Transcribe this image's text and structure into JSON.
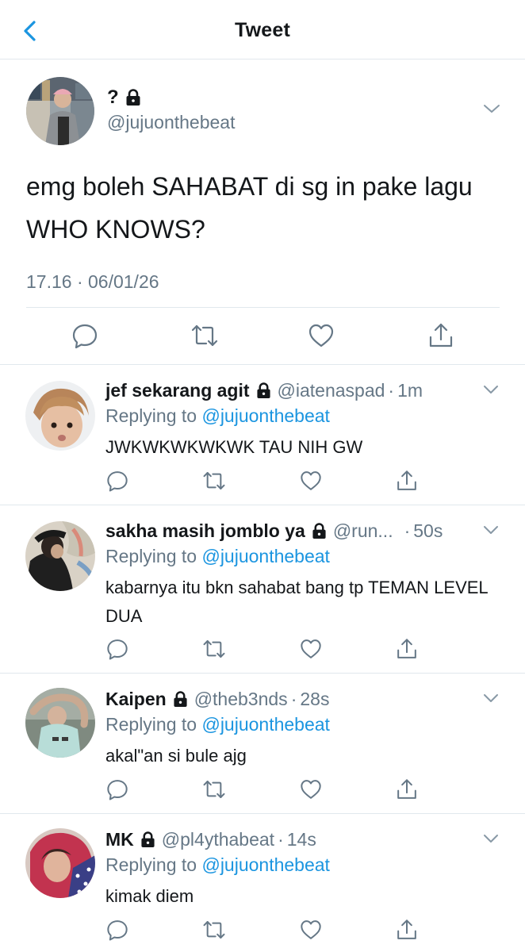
{
  "header": {
    "title": "Tweet",
    "accent_color": "#1b95e0"
  },
  "main_tweet": {
    "display_name": "?",
    "handle": "@jujuonthebeat",
    "text": "emg boleh SAHABAT di sg in pake lagu WHO KNOWS?",
    "timestamp": "17.16 · 06/01/26",
    "protected": true
  },
  "replies": [
    {
      "display_name": "jef sekarang agit",
      "handle": "@iatenaspad",
      "time": "1m",
      "replying_prefix": "Replying to ",
      "replying_to": "@jujuonthebeat",
      "text": "JWKWKWKWKWK TAU NIH GW"
    },
    {
      "display_name": "sakha masih jomblo ya",
      "handle": "@run...",
      "time": "50s",
      "replying_prefix": "Replying to ",
      "replying_to": "@jujuonthebeat",
      "text": "kabarnya itu bkn sahabat bang tp TEMAN LEVEL DUA"
    },
    {
      "display_name": "Kaipen",
      "handle": "@theb3nds",
      "time": "28s",
      "replying_prefix": "Replying to ",
      "replying_to": "@jujuonthebeat",
      "text": "akal\"an si bule ajg"
    },
    {
      "display_name": "MK",
      "handle": "@pl4ythabeat",
      "time": "14s",
      "replying_prefix": "Replying to ",
      "replying_to": "@jujuonthebeat",
      "text": "kimak diem"
    }
  ],
  "icons": {
    "back": "chevron-left-icon",
    "more": "chevron-down-icon",
    "protected": "lock-icon",
    "reply": "reply-icon",
    "retweet": "retweet-icon",
    "like": "heart-icon",
    "share": "share-icon"
  }
}
